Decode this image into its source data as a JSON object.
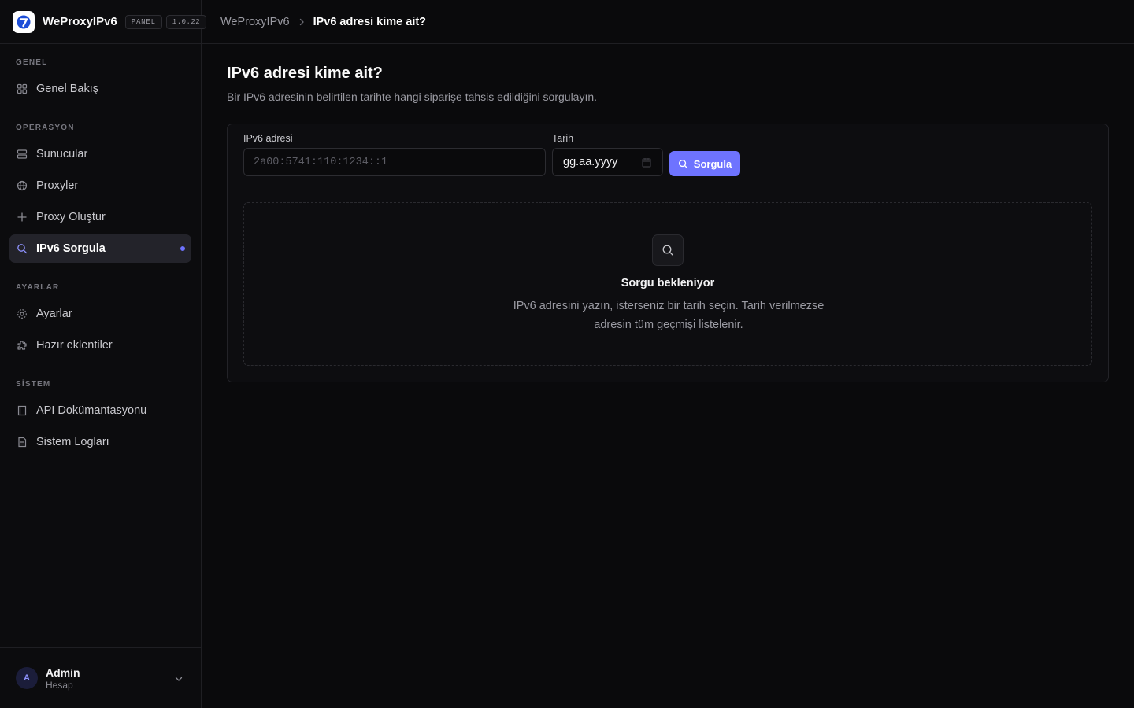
{
  "brand": {
    "name": "WeProxyIPv6",
    "badge": "PANEL",
    "version": "1.0.22"
  },
  "sidebar": {
    "sections": [
      {
        "label": "GENEL",
        "items": [
          {
            "label": "Genel Bakış",
            "icon": "grid-icon"
          }
        ]
      },
      {
        "label": "OPERASYON",
        "items": [
          {
            "label": "Sunucular",
            "icon": "server-icon"
          },
          {
            "label": "Proxyler",
            "icon": "globe-icon"
          },
          {
            "label": "Proxy Oluştur",
            "icon": "plus-icon"
          },
          {
            "label": "IPv6 Sorgula",
            "icon": "search-icon",
            "active": true
          }
        ]
      },
      {
        "label": "AYARLAR",
        "items": [
          {
            "label": "Ayarlar",
            "icon": "gear-icon"
          },
          {
            "label": "Hazır eklentiler",
            "icon": "puzzle-icon"
          }
        ]
      },
      {
        "label": "SİSTEM",
        "items": [
          {
            "label": "API Dokümantasyonu",
            "icon": "book-icon"
          },
          {
            "label": "Sistem Logları",
            "icon": "file-icon"
          }
        ]
      }
    ]
  },
  "user": {
    "initial": "A",
    "name": "Admin",
    "role": "Hesap"
  },
  "breadcrumb": {
    "home": "WeProxyIPv6",
    "current": "IPv6 adresi kime ait?"
  },
  "page": {
    "title": "IPv6 adresi kime ait?",
    "subtitle": "Bir IPv6 adresinin belirtilen tarihte hangi siparişe tahsis edildiğini sorgulayın."
  },
  "form": {
    "ipv6_label": "IPv6 adresi",
    "ipv6_placeholder": "2a00:5741:110:1234::1",
    "ipv6_value": "",
    "date_label": "Tarih",
    "date_placeholder": "gg.aa.yyyy",
    "submit_label": "Sorgula"
  },
  "empty_state": {
    "title": "Sorgu bekleniyor",
    "description": "IPv6 adresini yazın, isterseniz bir tarih seçin. Tarih verilmezse adresin tüm geçmişi listelenir."
  },
  "colors": {
    "accent": "#6e73ff",
    "background": "#0a0a0c",
    "active_item": "#23232a"
  }
}
